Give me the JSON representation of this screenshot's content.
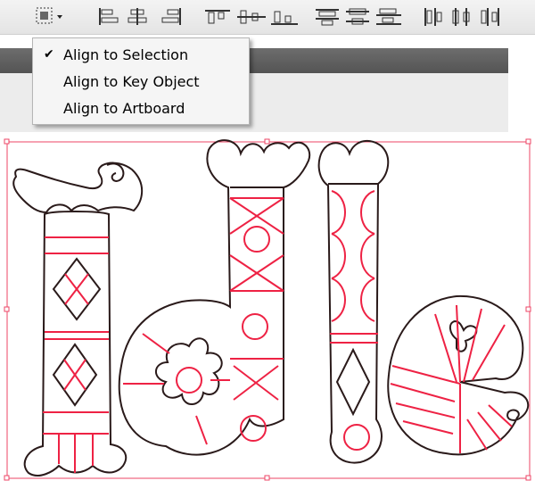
{
  "toolbar": {
    "buttons": [
      {
        "icon": "align-to-dropdown-icon"
      },
      {
        "icon": "horizontal-align-left-icon"
      },
      {
        "icon": "horizontal-align-center-icon"
      },
      {
        "icon": "horizontal-align-right-icon"
      },
      {
        "icon": "vertical-align-top-icon"
      },
      {
        "icon": "vertical-align-center-icon"
      },
      {
        "icon": "vertical-align-bottom-icon"
      },
      {
        "icon": "vertical-distribute-top-icon"
      },
      {
        "icon": "vertical-distribute-center-icon"
      },
      {
        "icon": "vertical-distribute-bottom-icon"
      },
      {
        "icon": "horizontal-distribute-left-icon"
      },
      {
        "icon": "horizontal-distribute-center-icon"
      },
      {
        "icon": "horizontal-distribute-right-icon"
      }
    ]
  },
  "menu": {
    "items": [
      {
        "label": "Align to Selection",
        "checked": true
      },
      {
        "label": "Align to Key Object",
        "checked": false
      },
      {
        "label": "Align to Artboard",
        "checked": false
      }
    ]
  },
  "colors": {
    "path_stroke": "#2a1a1a",
    "anchor_lines": "#ee2244",
    "selection_box": "#ee4466"
  }
}
